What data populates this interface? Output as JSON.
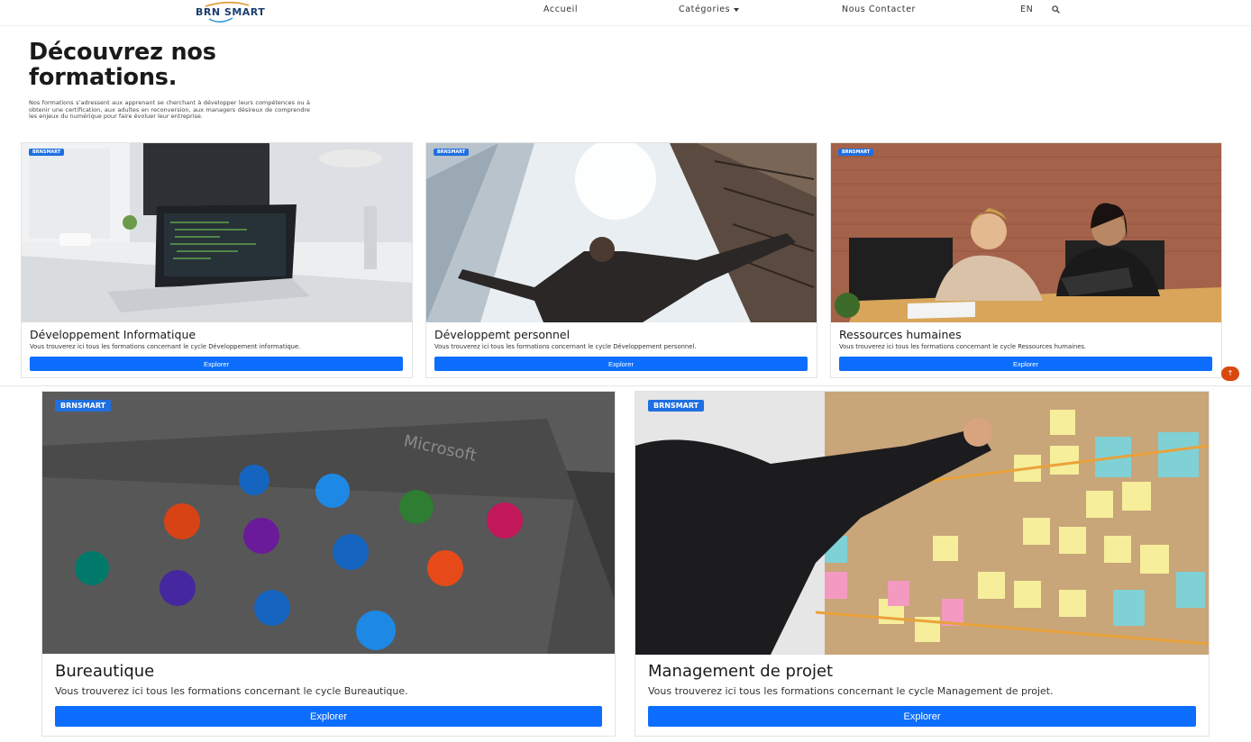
{
  "nav": {
    "logo": "BRN SMART",
    "links": [
      "Accueil",
      "Catégories",
      "Nous Contacter",
      "EN"
    ],
    "search_icon": "search-icon"
  },
  "hero": {
    "title": "Découvrez nos formations.",
    "description": "Nos formations s’adressent aux apprenant se cherchant à développer leurs compétences ou à obtenir une certification, aux adultes en reconversion, aux managers désireux de comprendre les enjeux du numérique pour faire évoluer leur entreprise."
  },
  "cards": [
    {
      "badge": "BRNSMART",
      "title": "Développement Informatique",
      "desc": "Vous trouverez ici tous les formations concernant le cycle Développement informatique.",
      "button": "Explorer"
    },
    {
      "badge": "BRNSMART",
      "title": "Développemt personnel",
      "desc": "Vous trouverez ici tous les formations concernant le cycle Développement personnel.",
      "button": "Explorer"
    },
    {
      "badge": "BRNSMART",
      "title": "Ressources humaines",
      "desc": "Vous trouverez ici tous les formations concernant le cycle Ressources humaines.",
      "button": "Explorer"
    },
    {
      "badge": "BRNSMART",
      "title": "Bureautique",
      "desc": "Vous trouverez ici tous les formations concernant le cycle Bureautique.",
      "button": "Explorer"
    },
    {
      "badge": "BRNSMART",
      "title": "Management de projet",
      "desc": "Vous trouverez ici tous les formations concernant le cycle Management de projet.",
      "button": "Explorer"
    }
  ],
  "colors": {
    "primary": "#0d6efd",
    "badge": "#1f6fe0",
    "scroll_top": "#d9480f"
  }
}
